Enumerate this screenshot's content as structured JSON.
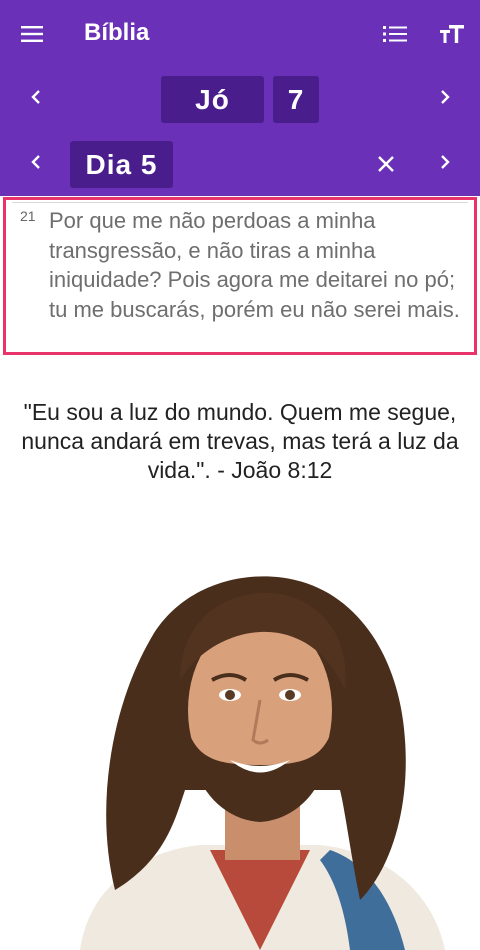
{
  "app": {
    "title": "Bíblia",
    "brand_color": "#6a31b8",
    "pill_color": "#4a1d8c",
    "highlight_color": "#e8336b"
  },
  "toolbar": {
    "menu_icon": "hamburger-menu-icon",
    "list_icon": "list-icon",
    "font_icon": "font-size-icon"
  },
  "navigation": {
    "book": "Jó",
    "chapter": "7",
    "day": "Dia 5"
  },
  "verse": {
    "number": "21",
    "text": "Por que me não perdoas a minha transgressão, e não tiras a minha iniquidade? Pois agora me deitarei no pó; tu me buscarás, porém eu não serei mais."
  },
  "quote": {
    "text": "\"Eu sou a luz do mundo. Quem me segue, nunca andará em trevas, mas terá a luz da vida.\". - João 8:12"
  }
}
